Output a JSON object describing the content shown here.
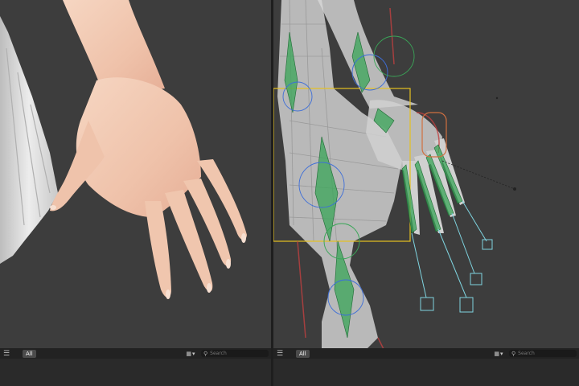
{
  "left_panel": {
    "header": {
      "menu_icon": "hamburger-menu-icon",
      "tab_label": "All",
      "filter_icon": "grid-filter-icon",
      "search_placeholder": "Search"
    }
  },
  "right_panel": {
    "header": {
      "menu_icon": "hamburger-menu-icon",
      "tab_label": "All",
      "filter_icon": "grid-filter-icon",
      "search_placeholder": "Search"
    }
  },
  "colors": {
    "viewport_bg": "#3d3d3d",
    "skin": "#f1c8b0",
    "cloth": "#e4e4e4",
    "bone_green": "#3aa658",
    "bone_blue": "#3d6ed8",
    "control_cyan": "#7fd4e0",
    "selection_yellow": "#e6c020",
    "constraint_red": "#c04040"
  }
}
